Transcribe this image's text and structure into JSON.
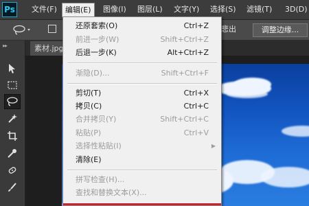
{
  "app": {
    "logo_text": "Ps"
  },
  "menubar": {
    "items": [
      {
        "label": "文件(F)"
      },
      {
        "label": "编辑(E)"
      },
      {
        "label": "图像(I)"
      },
      {
        "label": "图层(L)"
      },
      {
        "label": "文字(Y)"
      },
      {
        "label": "选择(S)"
      },
      {
        "label": "滤镜(T)"
      },
      {
        "label": "3D(D)"
      }
    ]
  },
  "options": {
    "partial_label": "悲出",
    "refine_edge_label": "调整边缘..."
  },
  "document": {
    "tab_label": "素材.jpg"
  },
  "toolbar": {
    "tools": [
      {
        "icon": "move-tool-icon"
      },
      {
        "icon": "rect-marquee-icon"
      },
      {
        "icon": "lasso-icon",
        "selected": true
      },
      {
        "icon": "magic-wand-icon"
      },
      {
        "icon": "crop-icon"
      },
      {
        "icon": "eyedropper-icon"
      },
      {
        "icon": "spot-healing-icon"
      },
      {
        "icon": "brush-icon"
      }
    ]
  },
  "edit_menu": {
    "items": [
      {
        "label": "还原套索(O)",
        "shortcut": "Ctrl+Z",
        "enabled": true
      },
      {
        "label": "前进一步(W)",
        "shortcut": "Shift+Ctrl+Z",
        "enabled": false
      },
      {
        "label": "后退一步(K)",
        "shortcut": "Alt+Ctrl+Z",
        "enabled": true
      },
      {
        "label": "渐隐(D)...",
        "shortcut": "Shift+Ctrl+F",
        "enabled": false
      },
      {
        "label": "剪切(T)",
        "shortcut": "Ctrl+X",
        "enabled": true
      },
      {
        "label": "拷贝(C)",
        "shortcut": "Ctrl+C",
        "enabled": true
      },
      {
        "label": "合并拷贝(Y)",
        "shortcut": "Shift+Ctrl+C",
        "enabled": false
      },
      {
        "label": "粘贴(P)",
        "shortcut": "Ctrl+V",
        "enabled": false
      },
      {
        "label": "选择性粘贴(I)",
        "shortcut": "",
        "enabled": false,
        "submenu": true
      },
      {
        "label": "清除(E)",
        "shortcut": "",
        "enabled": true
      },
      {
        "label": "拼写检查(H)...",
        "shortcut": "",
        "enabled": false
      },
      {
        "label": "查找和替换文本(X)...",
        "shortcut": "",
        "enabled": false
      }
    ]
  },
  "colors": {
    "menubar_bg": "#3c3c3c",
    "menu_bg": "#f0f0f0",
    "disabled_text": "#9c9c9c",
    "sky_blue": "#1356c2",
    "accent_red": "#c4262e"
  }
}
